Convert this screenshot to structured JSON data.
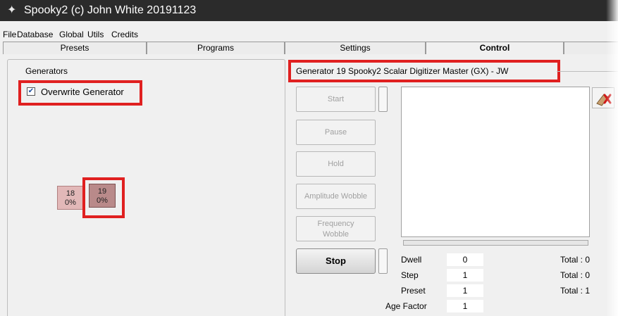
{
  "window": {
    "title": "Spooky2 (c) John White 20191123",
    "app_icon": "wizard-icon"
  },
  "menu": {
    "file": "File",
    "database": "Database",
    "global": "Global",
    "utils": "Utils",
    "credits": "Credits"
  },
  "tabs": {
    "presets": "Presets",
    "programs": "Programs",
    "settings": "Settings",
    "control": "Control",
    "active": "Control"
  },
  "generators": {
    "group_label": "Generators",
    "overwrite_label": "Overwrite Generator",
    "overwrite_checked": true,
    "items": [
      {
        "number": "18",
        "percent": "0%"
      },
      {
        "number": "19",
        "percent": "0%"
      }
    ]
  },
  "control": {
    "header": "Generator 19   Spooky2 Scalar Digitizer Master (GX) - JW",
    "start": "Start",
    "pause": "Pause",
    "hold": "Hold",
    "amplitude_wobble": "Amplitude Wobble",
    "frequency_wobble": "Frequency Wobble",
    "stop": "Stop",
    "erase_icon": "eraser-icon"
  },
  "stats": {
    "dwell": {
      "label": "Dwell",
      "value": "0",
      "total": "Total : 0"
    },
    "step": {
      "label": "Step",
      "value": "1",
      "total": "Total : 0"
    },
    "preset": {
      "label": "Preset",
      "value": "1",
      "total": "Total : 1"
    },
    "age_factor": {
      "label": "Age Factor",
      "value": "1"
    }
  },
  "colors": {
    "highlight": "#e02020",
    "gen18": "#e2b8b8",
    "gen19": "#b98a8a"
  }
}
